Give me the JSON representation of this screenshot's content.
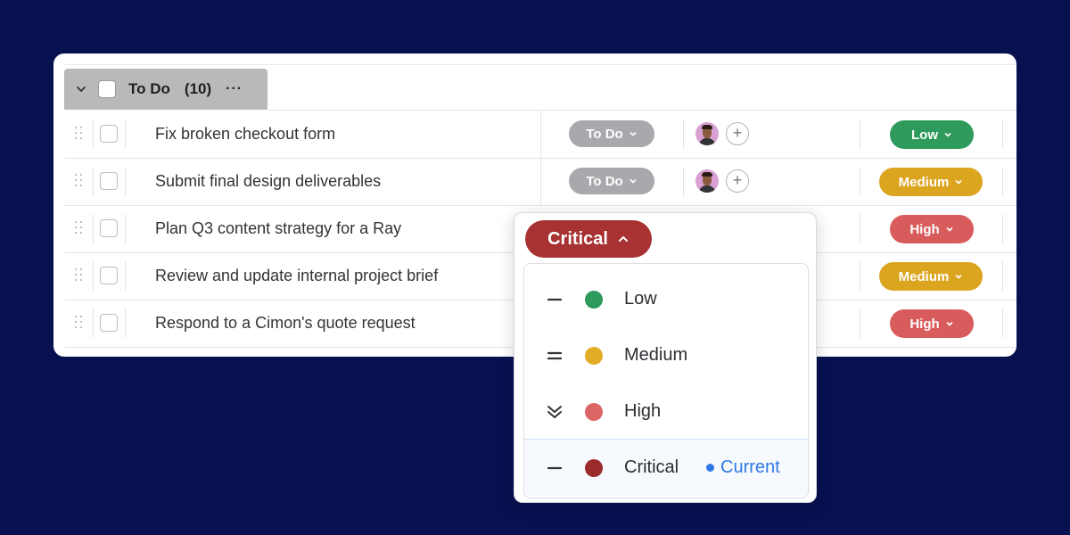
{
  "group": {
    "title": "To Do",
    "count": "(10)",
    "more": "···"
  },
  "tasks": [
    {
      "name": "Fix broken checkout form",
      "status": "To Do",
      "priority": "Low",
      "priority_color": "#2e9a5b"
    },
    {
      "name": "Submit final design deliverables",
      "status": "To Do",
      "priority": "Medium",
      "priority_color": "#dca51f"
    },
    {
      "name": "Plan Q3 content strategy for a Ray",
      "priority": "High",
      "priority_color": "#d95c5c"
    },
    {
      "name": "Review and update internal project brief",
      "priority": "Medium",
      "priority_color": "#dca51f"
    },
    {
      "name": "Respond to a Cimon's quote request",
      "priority": "High",
      "priority_color": "#d95c5c"
    }
  ],
  "popup": {
    "selected": "Critical",
    "selected_color": "#a83232",
    "options": [
      {
        "label": "Low",
        "icon": "dash-icon",
        "color": "#2e9a5b"
      },
      {
        "label": "Medium",
        "icon": "equals-icon",
        "color": "#e3ac26"
      },
      {
        "label": "High",
        "icon": "double-chevron-down-icon",
        "color": "#dc6565"
      },
      {
        "label": "Critical",
        "icon": "dash-icon",
        "color": "#9b2a2a",
        "current_label": "Current"
      }
    ]
  },
  "colors": {
    "background": "#071150",
    "status_gray": "#a9a9ad",
    "current_blue": "#2f7ae5"
  }
}
